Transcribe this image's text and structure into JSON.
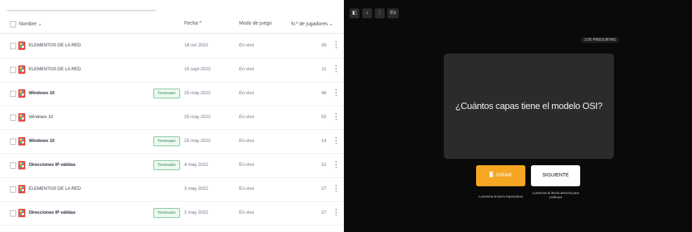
{
  "reports": {
    "columns": {
      "name": "Nombre ⌄",
      "date": "Fecha ^",
      "mode": "Modo de juego",
      "players": "N.º de jugadores ⌄"
    },
    "rows": [
      {
        "name": "ELEMENTOS DE LA RED",
        "bold": false,
        "badge": "",
        "date": "18 oct 2022",
        "mode": "En vivo",
        "players": "28"
      },
      {
        "name": "ELEMENTOS DE LA RED",
        "bold": false,
        "badge": "",
        "date": "15 sept 2022",
        "mode": "En vivo",
        "players": "11"
      },
      {
        "name": "Windows 10",
        "bold": true,
        "badge": "Terminado",
        "date": "25 may 2022",
        "mode": "En vivo",
        "players": "46"
      },
      {
        "name": "Windows 10",
        "bold": false,
        "badge": "",
        "date": "25 may 2022",
        "mode": "En vivo",
        "players": "55"
      },
      {
        "name": "Windows 10",
        "bold": true,
        "badge": "Terminado",
        "date": "25 may 2022",
        "mode": "En vivo",
        "players": "14"
      },
      {
        "name": "Direcciones IP válidas",
        "bold": true,
        "badge": "Terminado",
        "date": "4 may 2022",
        "mode": "En vivo",
        "players": "31"
      },
      {
        "name": "ELEMENTOS DE LA RED",
        "bold": false,
        "badge": "",
        "date": "3 may 2022",
        "mode": "En vivo",
        "players": "27"
      },
      {
        "name": "Direcciones IP válidas",
        "bold": true,
        "badge": "Terminado",
        "date": "2 may 2022",
        "mode": "En vivo",
        "players": "27"
      }
    ]
  },
  "quiz": {
    "toolbar": [
      "◧",
      "♪",
      "⋮",
      "Es"
    ],
    "question_counter": "1/20 PREGUNTAS",
    "question": "¿Cuántos capas tiene el modelo OSI?",
    "show_button": "GIRAR",
    "next_button": "SIGUIENTE",
    "hint_left": "o presiona la barra espaciadora",
    "hint_right": "o presiona la flecha derecha para continuar"
  },
  "colors": {
    "badge_green": "#2f8a55",
    "accent_orange": "#f5a623",
    "quiz_bg": "#0a0a0a",
    "card_bg": "#2b2b2b"
  }
}
